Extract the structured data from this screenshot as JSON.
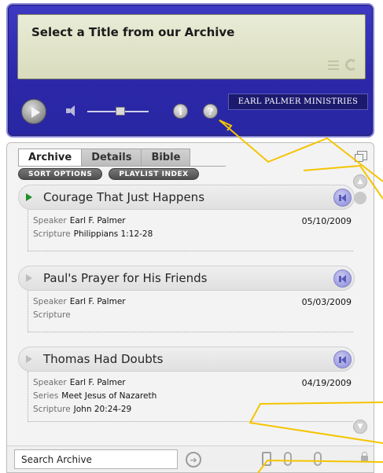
{
  "player": {
    "display_title": "Select a Title from our Archive",
    "brand": "EARL PALMER MINISTRIES",
    "volume_level": 0.6
  },
  "tabs": [
    {
      "label": "Archive",
      "active": true
    },
    {
      "label": "Details",
      "active": false
    },
    {
      "label": "Bible",
      "active": false
    }
  ],
  "pills": {
    "sort": "SORT OPTIONS",
    "playlist": "PLAYLIST INDEX"
  },
  "items": [
    {
      "title": "Courage That Just Happens",
      "active": true,
      "date": "05/10/2009",
      "rows": [
        {
          "label": "Speaker",
          "value": "Earl F. Palmer"
        },
        {
          "label": "Scripture",
          "value": "Philippians 1:12-28"
        }
      ]
    },
    {
      "title": "Paul's Prayer for His Friends",
      "active": false,
      "date": "05/03/2009",
      "rows": [
        {
          "label": "Speaker",
          "value": "Earl F. Palmer"
        },
        {
          "label": "Scripture",
          "value": ""
        }
      ]
    },
    {
      "title": "Thomas Had Doubts",
      "active": false,
      "date": "04/19/2009",
      "rows": [
        {
          "label": "Speaker",
          "value": "Earl F. Palmer"
        },
        {
          "label": "Series",
          "value": "Meet Jesus of Nazareth"
        },
        {
          "label": "Scripture",
          "value": "John 20:24-29"
        }
      ]
    }
  ],
  "search": {
    "value": "Search Archive"
  },
  "colors": {
    "player_bg": "#2b27a8",
    "display_bg": "#e0e3c6",
    "active_triangle": "#1f8f2b",
    "annotation": "#f5c400"
  }
}
